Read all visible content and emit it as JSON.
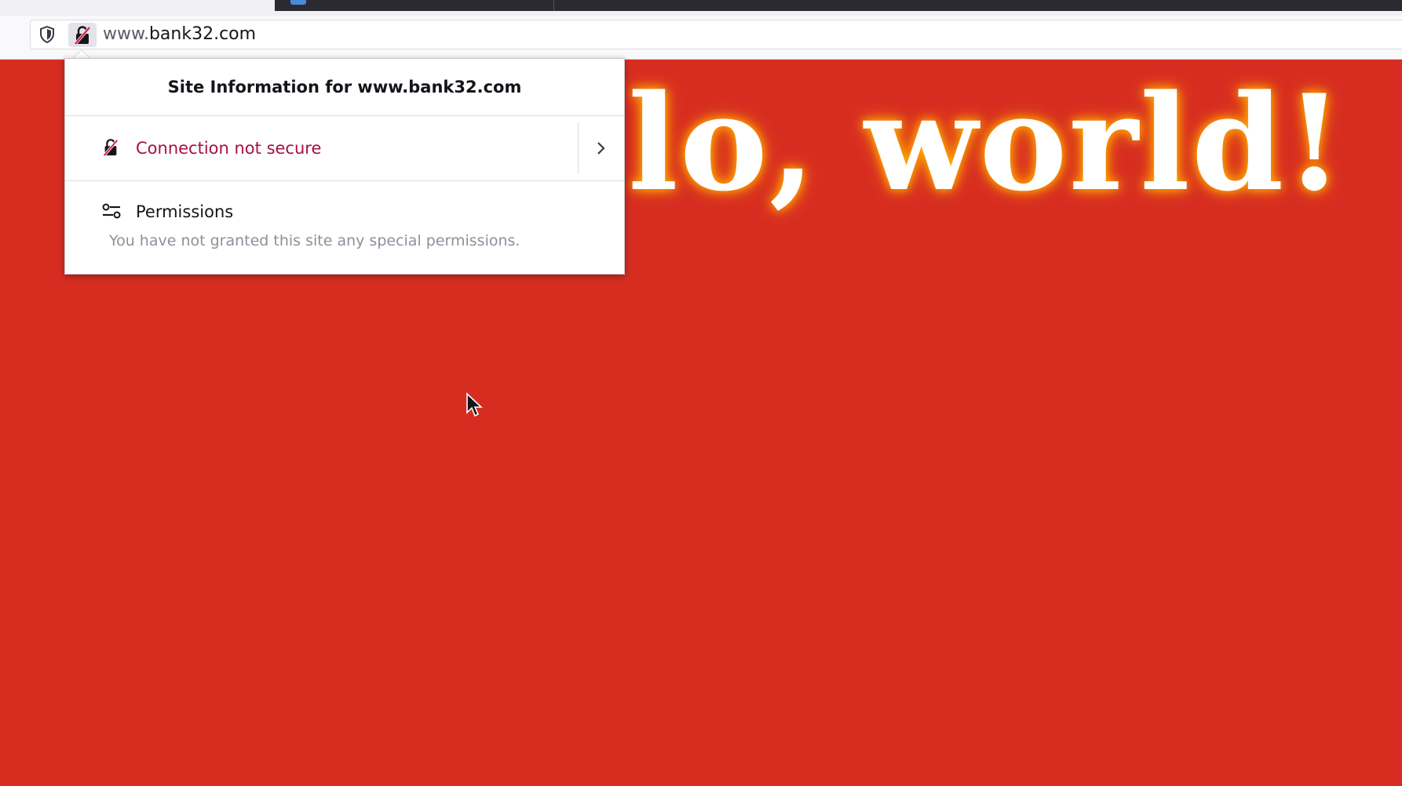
{
  "browser": {
    "url_prefix": "www.",
    "url_domain": "bank32.com",
    "shield_icon": "tracking-protection-shield-icon",
    "identity_icon": "insecure-lock-icon"
  },
  "page": {
    "heading": "lo, world!",
    "background_color": "#d72d21"
  },
  "site_info_popup": {
    "title": "Site Information for www.bank32.com",
    "connection": {
      "label": "Connection not secure",
      "icon": "insecure-lock-icon",
      "more_icon": "chevron-right-icon",
      "color": "#a4123d"
    },
    "permissions": {
      "title": "Permissions",
      "icon": "permissions-sliders-icon",
      "description": "You have not granted this site any special permissions."
    }
  }
}
